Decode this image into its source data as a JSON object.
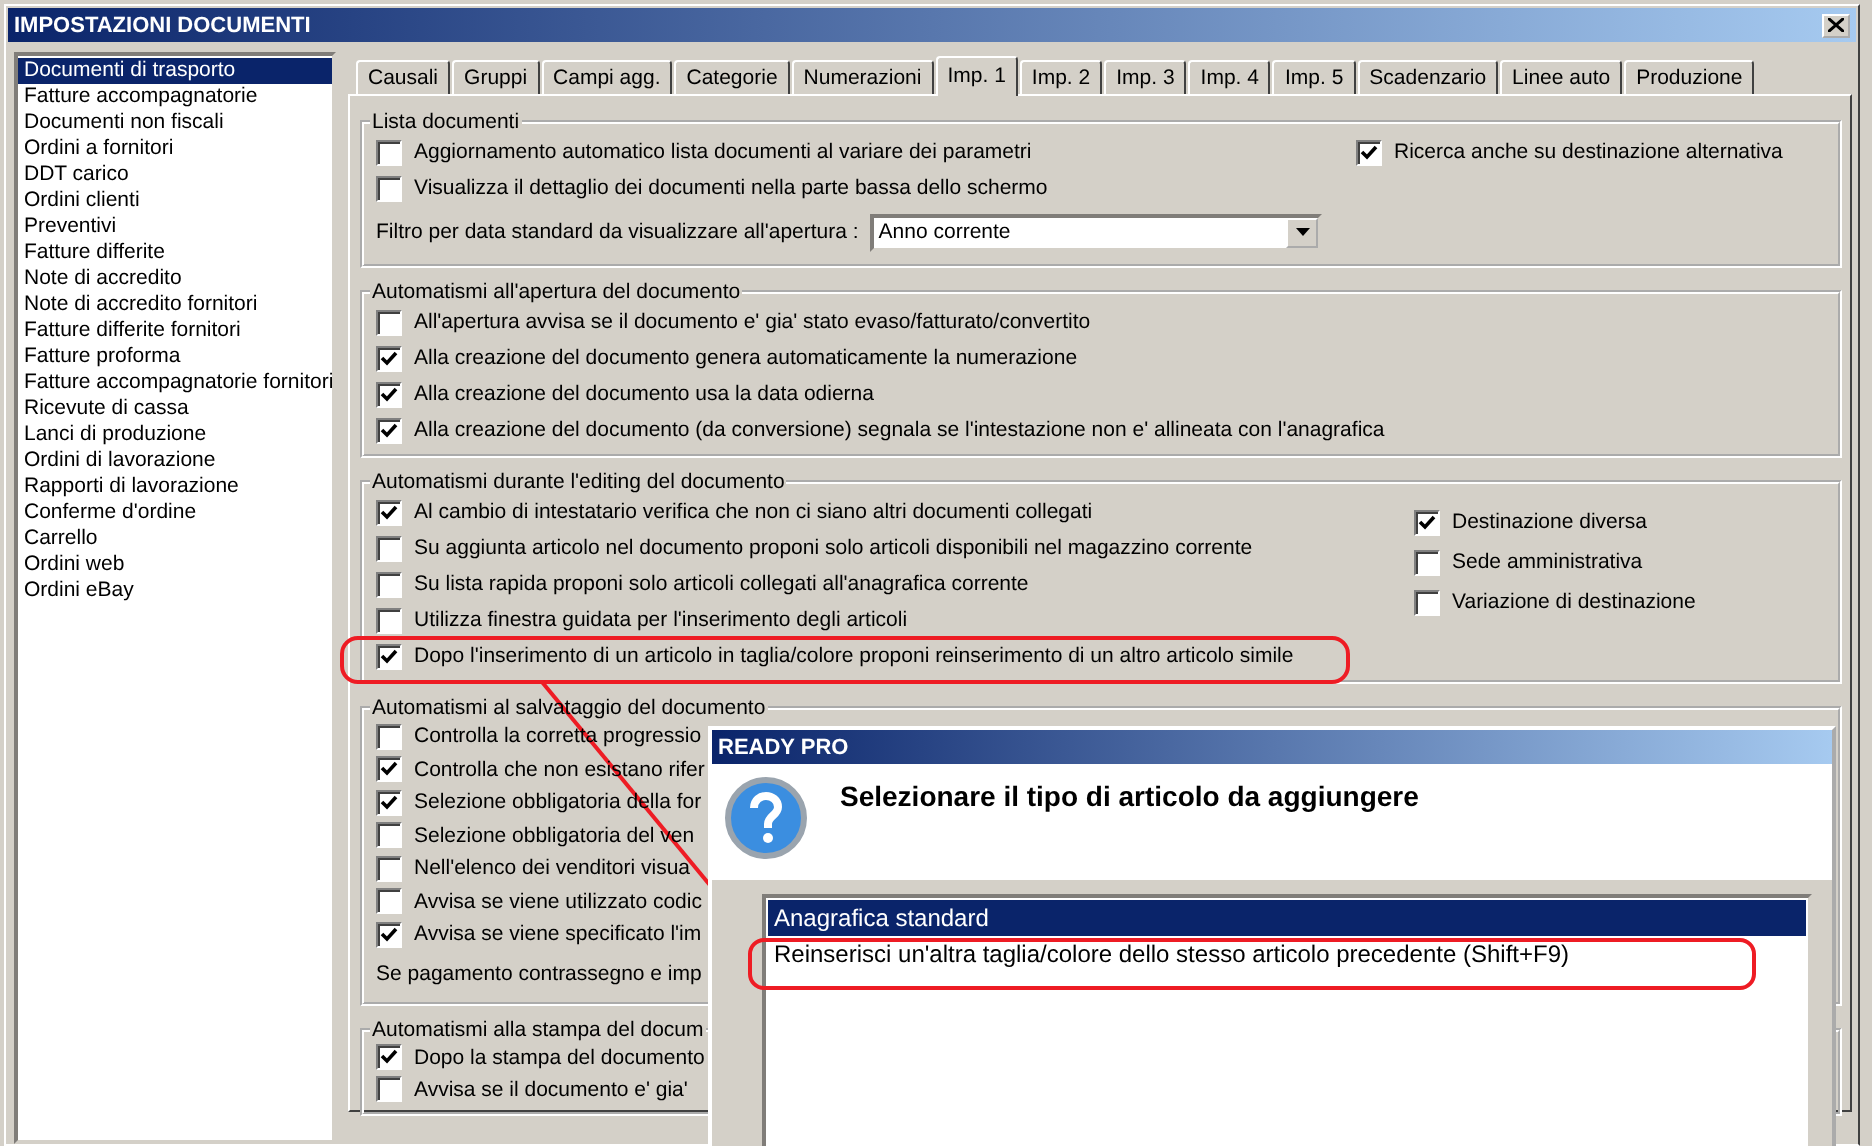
{
  "window": {
    "title": "IMPOSTAZIONI DOCUMENTI"
  },
  "sidebar": {
    "items": [
      {
        "label": "Documenti di trasporto",
        "selected": true
      },
      {
        "label": "Fatture accompagnatorie",
        "selected": false
      },
      {
        "label": "Documenti non fiscali",
        "selected": false
      },
      {
        "label": "Ordini a fornitori",
        "selected": false
      },
      {
        "label": "DDT carico",
        "selected": false
      },
      {
        "label": "Ordini clienti",
        "selected": false
      },
      {
        "label": "Preventivi",
        "selected": false
      },
      {
        "label": "Fatture differite",
        "selected": false
      },
      {
        "label": "Note di accredito",
        "selected": false
      },
      {
        "label": "Note di accredito fornitori",
        "selected": false
      },
      {
        "label": "Fatture differite fornitori",
        "selected": false
      },
      {
        "label": "Fatture proforma",
        "selected": false
      },
      {
        "label": "Fatture accompagnatorie fornitori",
        "selected": false
      },
      {
        "label": "Ricevute di cassa",
        "selected": false
      },
      {
        "label": "Lanci di produzione",
        "selected": false
      },
      {
        "label": "Ordini di lavorazione",
        "selected": false
      },
      {
        "label": "Rapporti di lavorazione",
        "selected": false
      },
      {
        "label": "Conferme d'ordine",
        "selected": false
      },
      {
        "label": "Carrello",
        "selected": false
      },
      {
        "label": "Ordini web",
        "selected": false
      },
      {
        "label": "Ordini eBay",
        "selected": false
      }
    ]
  },
  "tabs": [
    {
      "label": "Causali",
      "selected": false
    },
    {
      "label": "Gruppi",
      "selected": false
    },
    {
      "label": "Campi agg.",
      "selected": false
    },
    {
      "label": "Categorie",
      "selected": false
    },
    {
      "label": "Numerazioni",
      "selected": false
    },
    {
      "label": "Imp. 1",
      "selected": true
    },
    {
      "label": "Imp. 2",
      "selected": false
    },
    {
      "label": "Imp. 3",
      "selected": false
    },
    {
      "label": "Imp. 4",
      "selected": false
    },
    {
      "label": "Imp. 5",
      "selected": false
    },
    {
      "label": "Scadenzario",
      "selected": false
    },
    {
      "label": "Linee auto",
      "selected": false
    },
    {
      "label": "Produzione",
      "selected": false
    }
  ],
  "groups": [
    {
      "title": "Lista documenti",
      "left": [
        {
          "kind": "checkbox",
          "label": "Aggiornamento automatico lista documenti al variare dei parametri",
          "checked": false
        },
        {
          "kind": "checkbox",
          "label": "Visualizza il dettaglio dei documenti nella parte bassa dello schermo",
          "checked": false
        },
        {
          "kind": "dropdown",
          "label": "Filtro per data standard da visualizzare all'apertura :",
          "value": "Anno corrente"
        }
      ],
      "right": [
        {
          "kind": "checkbox",
          "label": "Ricerca anche su destinazione alternativa",
          "checked": true
        }
      ]
    },
    {
      "title": "Automatismi all'apertura del documento",
      "left": [
        {
          "kind": "checkbox",
          "label": "All'apertura avvisa se il documento e' gia' stato evaso/fatturato/convertito",
          "checked": false
        },
        {
          "kind": "checkbox",
          "label": "Alla creazione del documento genera automaticamente la numerazione",
          "checked": true
        },
        {
          "kind": "checkbox",
          "label": "Alla creazione del documento usa la data odierna",
          "checked": true
        },
        {
          "kind": "checkbox",
          "label": "Alla creazione del documento (da conversione) segnala se l'intestazione non e' allineata con l'anagrafica",
          "checked": true
        }
      ]
    },
    {
      "title": "Automatismi durante l'editing del documento",
      "left": [
        {
          "kind": "checkbox",
          "label": "Al cambio di intestatario verifica che non ci siano altri documenti collegati",
          "checked": true
        },
        {
          "kind": "checkbox",
          "label": "Su aggiunta articolo nel documento proponi solo articoli disponibili nel magazzino corrente",
          "checked": false
        },
        {
          "kind": "checkbox",
          "label": "Su lista rapida proponi solo articoli collegati all'anagrafica corrente",
          "checked": false
        },
        {
          "kind": "checkbox",
          "label": "Utilizza finestra guidata per l'inserimento degli articoli",
          "checked": false
        },
        {
          "kind": "checkbox",
          "label": "Dopo l'inserimento di un articolo in taglia/colore proponi reinserimento di un altro articolo simile",
          "checked": true
        }
      ],
      "right": [
        {
          "kind": "checkbox",
          "label": "Destinazione diversa",
          "checked": true
        },
        {
          "kind": "checkbox",
          "label": "Sede amministrativa",
          "checked": false
        },
        {
          "kind": "checkbox",
          "label": "Variazione di destinazione",
          "checked": false
        }
      ]
    },
    {
      "title": "Automatismi al salvataggio del documento",
      "left": [
        {
          "kind": "checkbox",
          "label": "Controlla la corretta progressio",
          "checked": false
        },
        {
          "kind": "checkbox",
          "label": "Controlla che non esistano rifer",
          "checked": true
        },
        {
          "kind": "checkbox",
          "label": "Selezione obbligatoria della for",
          "checked": true
        },
        {
          "kind": "checkbox",
          "label": "Selezione obbligatoria del ven",
          "checked": false
        },
        {
          "kind": "checkbox",
          "label": "Nell'elenco dei venditori visua",
          "checked": false
        },
        {
          "kind": "checkbox",
          "label": "Avvisa se viene utilizzato codic",
          "checked": false
        },
        {
          "kind": "checkbox",
          "label": "Avvisa se viene specificato l'im",
          "checked": true
        },
        {
          "kind": "text",
          "label": "Se pagamento contrassegno e imp"
        }
      ]
    },
    {
      "title": "Automatismi alla stampa del docum",
      "left": [
        {
          "kind": "checkbox",
          "label": "Dopo la stampa del documento",
          "checked": true
        },
        {
          "kind": "checkbox",
          "label": "Avvisa se il documento e' gia'",
          "checked": false
        }
      ]
    }
  ],
  "dialog": {
    "title": "READY PRO",
    "message": "Selezionare il tipo di articolo da aggiungere",
    "options": [
      {
        "label": "Anagrafica standard",
        "selected": true
      },
      {
        "label": "Reinserisci un'altra taglia/colore dello stesso articolo precedente (Shift+F9)",
        "selected": false
      }
    ]
  }
}
